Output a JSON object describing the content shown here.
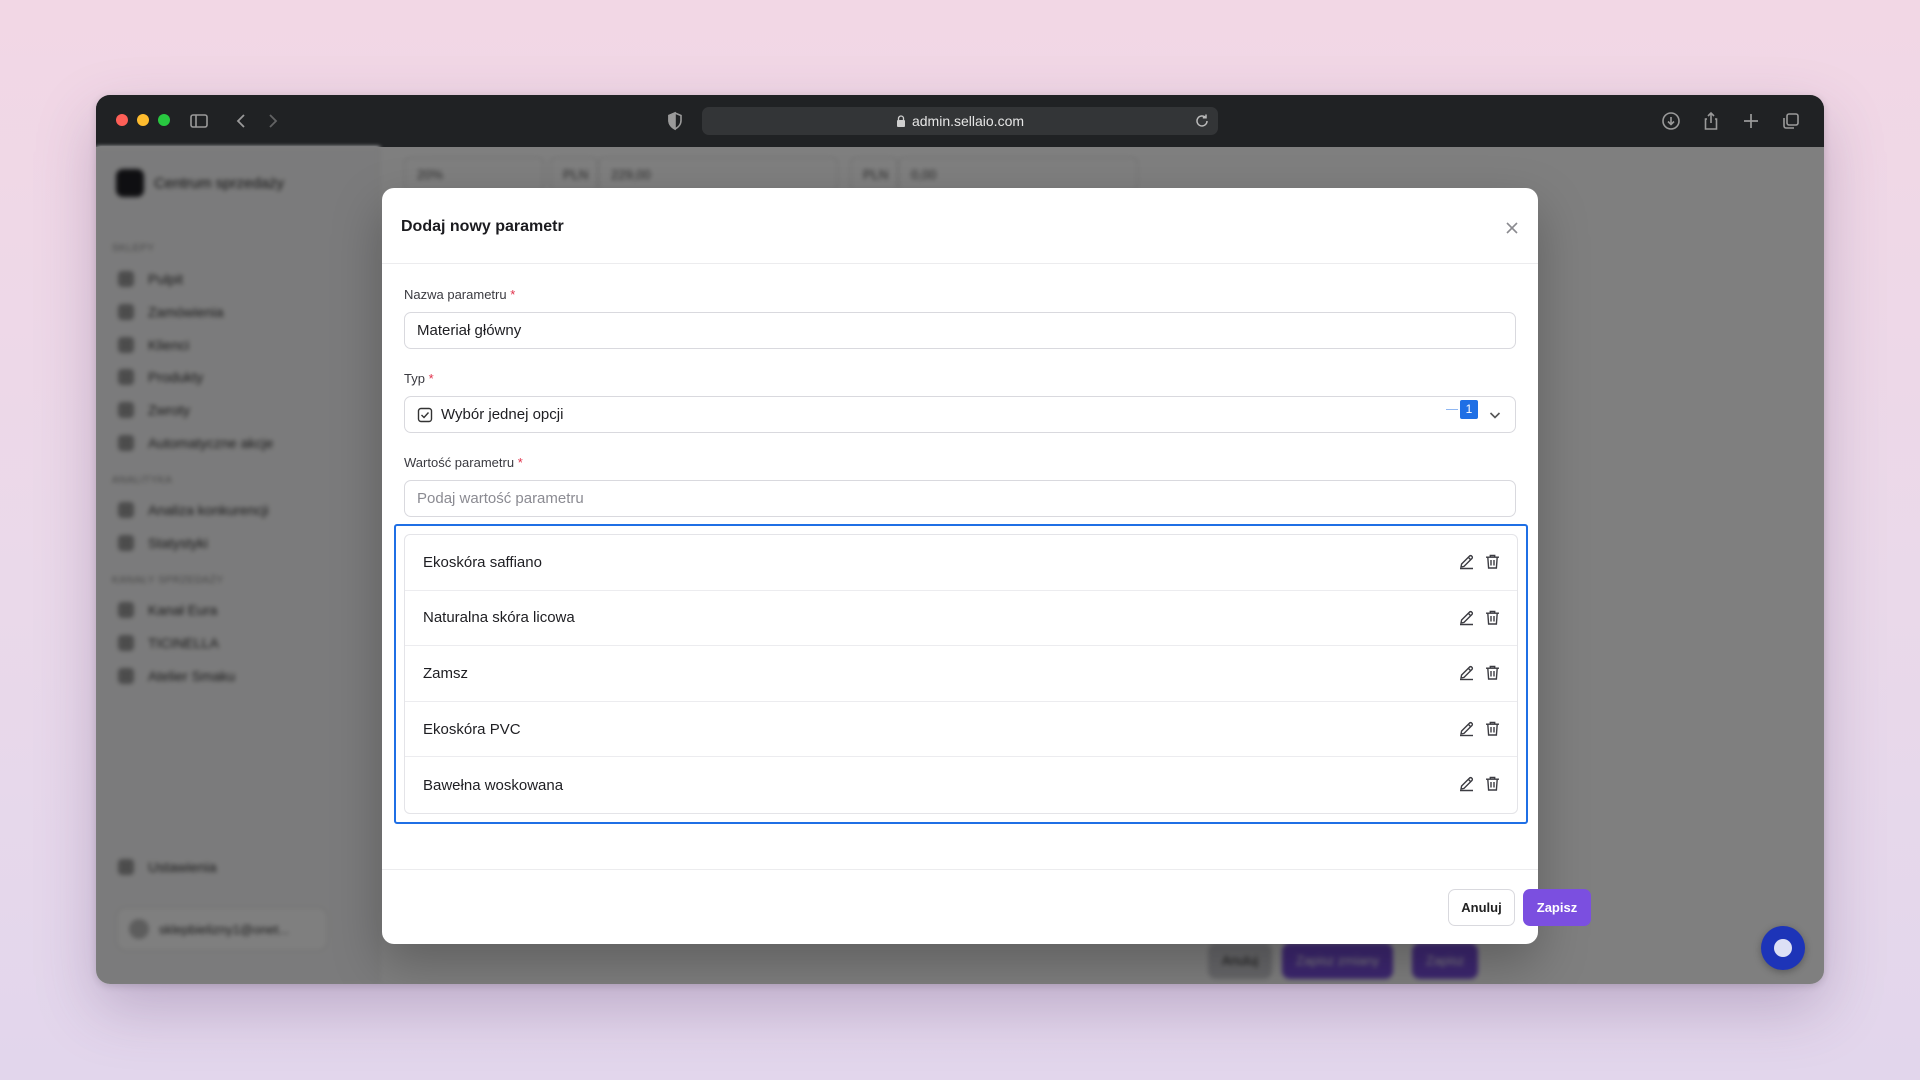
{
  "browser": {
    "url": "admin.sellaio.com"
  },
  "background": {
    "brand": "Centrum sprzedaży",
    "sections": [
      {
        "label": "Sklepy",
        "items": [
          "Pulpit",
          "Zamówienia",
          "Klienci",
          "Produkty",
          "Zwroty",
          "Automatyczne akcje"
        ]
      },
      {
        "label": "Analityka",
        "items": [
          "Analiza konkurencji",
          "Statystyki"
        ]
      },
      {
        "label": "Kanały sprzedaży",
        "items": [
          "Kanał Eura",
          "TICINELLA",
          "Atelier Smaku"
        ]
      }
    ],
    "settings": "Ustawienia",
    "user": "sklepbielizny1@onet...",
    "field_values": [
      "20%",
      "PLN",
      "229,00",
      "PLN",
      "0,00"
    ],
    "buttons": [
      "Anuluj",
      "Zapisz zmiany",
      "Zapisz"
    ]
  },
  "modal": {
    "title": "Dodaj nowy parametr",
    "name_label": "Nazwa parametru",
    "name_value": "Materiał główny",
    "type_label": "Typ",
    "type_value": "Wybór jednej opcji",
    "value_label": "Wartość parametru",
    "value_placeholder": "Podaj wartość parametru",
    "required_mark": "*",
    "options": [
      "Ekoskóra saffiano",
      "Naturalna skóra licowa",
      "Zamsz",
      "Ekoskóra PVC",
      "Bawełna woskowana"
    ],
    "highlight_badge": "1",
    "cancel_label": "Anuluj",
    "save_label": "Zapisz"
  },
  "colors": {
    "accent": "#7b4fe0",
    "highlight": "#1f6fe5",
    "required": "#e0304a"
  }
}
